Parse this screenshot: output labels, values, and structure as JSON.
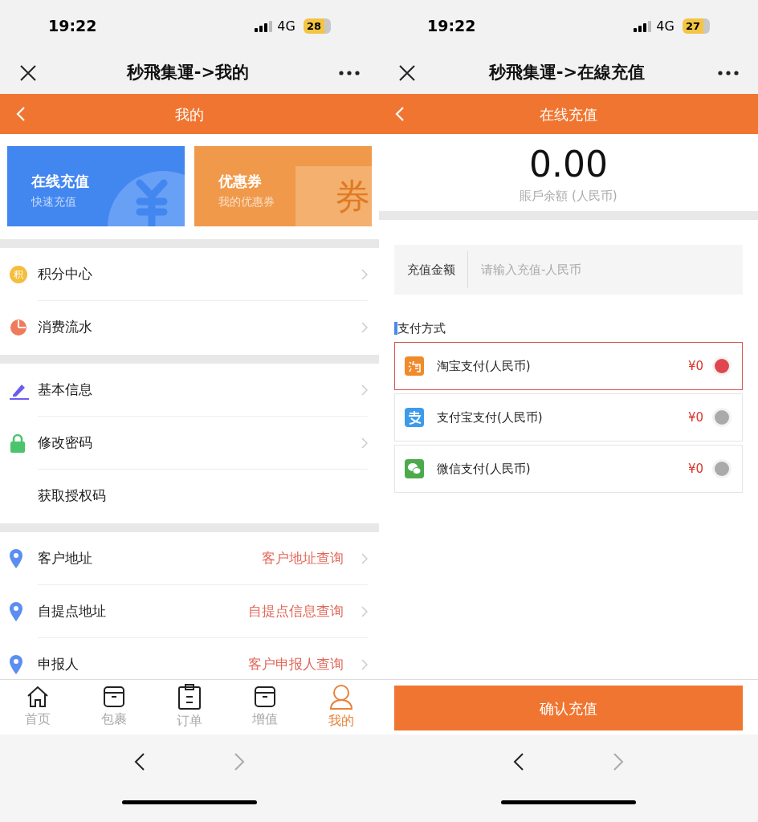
{
  "left": {
    "status": {
      "time": "19:22",
      "network": "4G",
      "battery": "28"
    },
    "title": "秒飛集運->我的",
    "header": "我的",
    "cards": [
      {
        "kind": "recharge",
        "title": "在线充值",
        "subtitle": "快速充值"
      },
      {
        "kind": "coupon",
        "title": "优惠券",
        "subtitle": "我的优惠券",
        "stamp": "券"
      }
    ],
    "groups": [
      [
        {
          "kind": "points",
          "label": "积分中心",
          "badge": "积"
        },
        {
          "kind": "expense",
          "label": "消费流水"
        }
      ],
      [
        {
          "kind": "edit",
          "label": "基本信息"
        },
        {
          "kind": "lock",
          "label": "修改密码"
        },
        {
          "kind": "plain",
          "label": "获取授权码"
        }
      ],
      [
        {
          "kind": "location",
          "label": "客户地址",
          "link": "客户地址查询"
        },
        {
          "kind": "location",
          "label": "自提点地址",
          "link": "自提点信息查询"
        },
        {
          "kind": "location",
          "label": "申报人",
          "link": "客户申报人查询"
        }
      ]
    ],
    "tabs": [
      {
        "kind": "home",
        "label": "首页",
        "selected": false
      },
      {
        "kind": "box",
        "label": "包裹",
        "selected": false
      },
      {
        "kind": "clipboard",
        "label": "订单",
        "selected": false
      },
      {
        "kind": "box",
        "label": "增值",
        "selected": false
      },
      {
        "kind": "user",
        "label": "我的",
        "selected": true
      }
    ],
    "forward_disabled": true
  },
  "right": {
    "status": {
      "time": "19:22",
      "network": "4G",
      "battery": "27"
    },
    "title": "秒飛集運->在線充值",
    "header": "在线充值",
    "balance": "0.00",
    "balance_label": "賬戶余額 (人民币)",
    "amount": {
      "label": "充值金额",
      "placeholder": "请输入充值-人民币"
    },
    "section": "支付方式",
    "methods": [
      {
        "kind": "taobao",
        "label": "淘宝支付(人民币)",
        "amount": "¥0",
        "selected": true
      },
      {
        "kind": "alipay",
        "label": "支付宝支付(人民币)",
        "amount": "¥0",
        "selected": false
      },
      {
        "kind": "wechat",
        "label": "微信支付(人民币)",
        "amount": "¥0",
        "selected": false
      }
    ],
    "button": "确认充值",
    "forward_disabled": true
  }
}
